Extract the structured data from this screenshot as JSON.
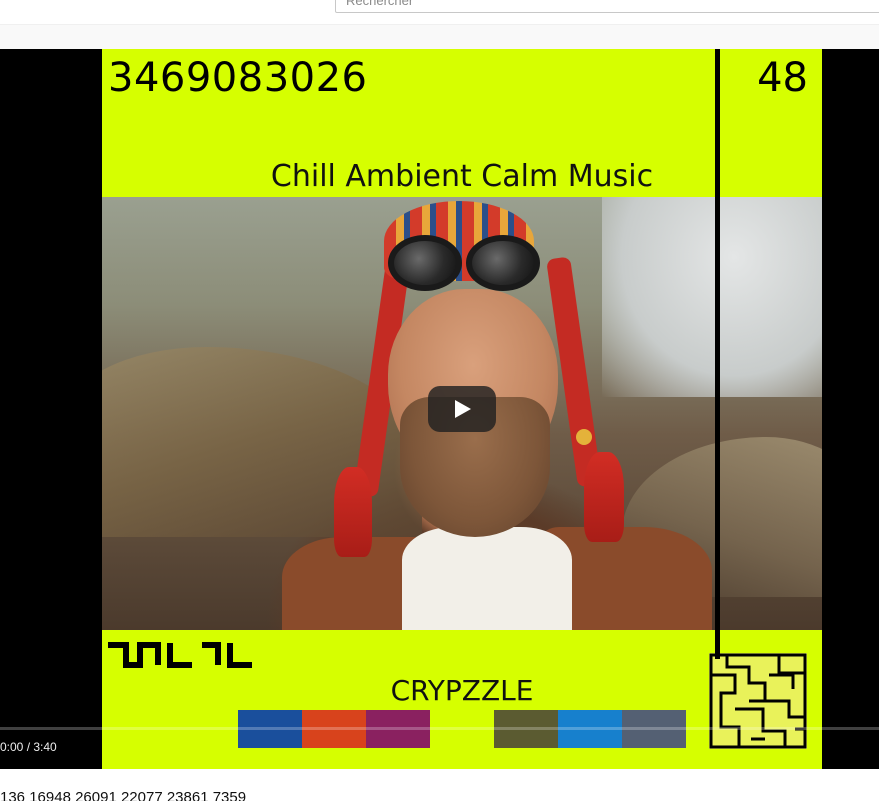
{
  "search": {
    "placeholder": "Rechercher"
  },
  "video": {
    "number": "3469083026",
    "corner_number": "48",
    "subtitle": "Chill Ambient Calm Music",
    "brand": "CRYPZZLE",
    "logo_icon": "crypzzle-logo-icon",
    "maze_icon": "maze-icon",
    "swatch_colors": [
      "#1a4f9c",
      "#d8431c",
      "#8a2160",
      "#d6ff00",
      "#5b5b31",
      "#1780cd",
      "#546073"
    ],
    "play_icon": "play-icon"
  },
  "controls": {
    "time": "0:00 / 3:40",
    "progress": 0
  },
  "description": {
    "text": "136 16948 26091 22077 23861 7359"
  },
  "colors": {
    "accent": "#d6ff00",
    "player_bg": "#000000"
  }
}
